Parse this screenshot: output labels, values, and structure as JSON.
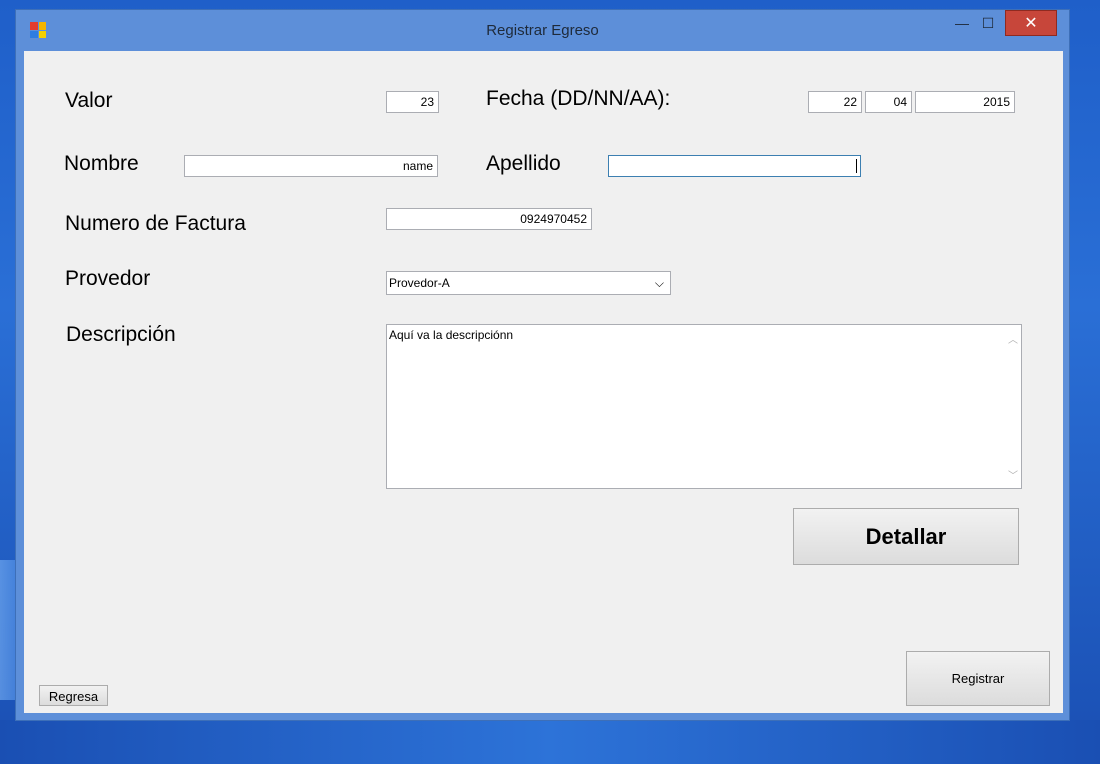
{
  "window": {
    "title": "Registrar Egreso",
    "close_glyph": "✕",
    "minimize_glyph": "—",
    "maximize_glyph": "☐"
  },
  "form": {
    "valor_label": "Valor",
    "valor_value": "23",
    "fecha_label": "Fecha (DD/NN/AA):",
    "fecha_day": "22",
    "fecha_month": "04",
    "fecha_year": "2015",
    "nombre_label": "Nombre",
    "nombre_value": "name",
    "apellido_label": "Apellido",
    "apellido_value": "",
    "factura_label": "Numero de Factura",
    "factura_value": "0924970452",
    "provedor_label": "Provedor",
    "provedor_selected": "Provedor-A",
    "descripcion_label": "Descripción",
    "descripcion_value": "Aquí va la descripciónn"
  },
  "buttons": {
    "detallar": "Detallar",
    "registrar": "Registrar",
    "regresa": "Regresa"
  },
  "icons": {
    "app": "app-icon",
    "combo_arrow": "chevron-down-icon"
  }
}
